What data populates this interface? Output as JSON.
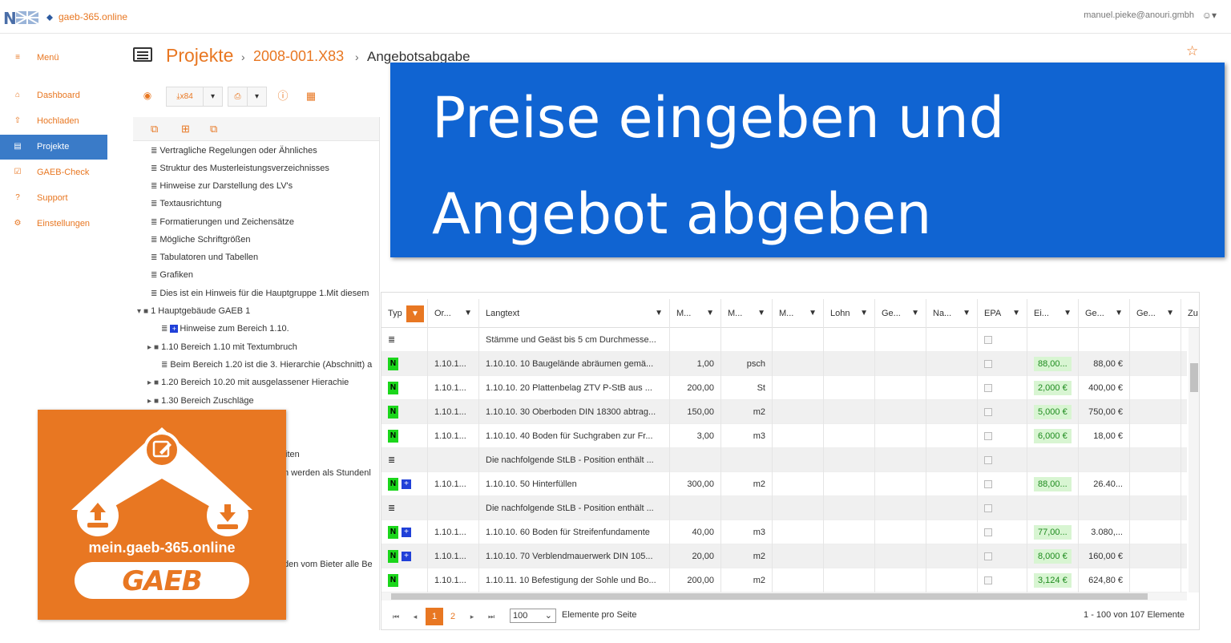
{
  "topbar": {
    "brand": "gaeb-365.online",
    "user": "manuel.pieke@anouri.gmbh",
    "user_icon": "☺▾"
  },
  "sidebar": {
    "items": [
      {
        "icon": "≡",
        "label": "Menü",
        "active": false
      },
      {
        "icon": "⌂",
        "label": "Dashboard",
        "active": false
      },
      {
        "icon": "⇧",
        "label": "Hochladen",
        "active": false
      },
      {
        "icon": "▤",
        "label": "Projekte",
        "active": true
      },
      {
        "icon": "☑",
        "label": "GAEB-Check",
        "active": false
      },
      {
        "icon": "?",
        "label": "Support",
        "active": false
      },
      {
        "icon": "⚙",
        "label": "Einstellungen",
        "active": false
      }
    ]
  },
  "breadcrumb": {
    "root": "Projekte",
    "sep1": "›",
    "project": "2008-001.X83",
    "sep2": "›",
    "page": "Angebotsabgabe"
  },
  "toolbar": {
    "eye": "◉",
    "export_label": "⤓x84",
    "caret": "▾",
    "pdf": "⎙",
    "info": "ⓘ",
    "calc": "▦"
  },
  "tree": {
    "head_icons": [
      "⧉",
      "⊞",
      "⧉"
    ],
    "nodes": [
      "Vertragliche Regelungen oder Ähnliches",
      "Struktur des Musterleistungsverzeichnisses",
      "Hinweise zur Darstellung des LV's",
      "Textausrichtung",
      "Formatierungen und Zeichensätze",
      "Mögliche Schriftgrößen",
      "Tabulatoren und Tabellen",
      "Grafiken",
      "Dies ist ein Hinweis für die Hauptgruppe 1.Mit diesem",
      "1 Hauptgebäude GAEB 1",
      "Hinweise zum Bereich 1.10.",
      "1.10 Bereich 1.10 mit Textumbruch",
      "Beim Bereich 1.20 ist die 3. Hierarchie (Abschnitt) a",
      "1.20 Bereich 10.20 mit ausgelassener Hierachie",
      "1.30 Bereich Zuschläge",
      "iten",
      "n werden als Stundenl",
      "den vom Bieter alle Be"
    ],
    "expand": "▸",
    "collapse": "▾",
    "text_icon": "≣",
    "book_icon": "■",
    "plus": "+"
  },
  "grid": {
    "headers": [
      "Typ",
      "Or...",
      "Langtext",
      "M...",
      "M...",
      "M...",
      "Lohn",
      "Ge...",
      "Na...",
      "EPA",
      "Ei...",
      "Ge...",
      "Ge...",
      "Zu"
    ],
    "filter_icon": "▼",
    "rows": [
      {
        "typ": "text",
        "ord": "",
        "lang": "Stämme und Geäst bis 5 cm Durchmesse...",
        "menge": "",
        "einheit": "",
        "ep": "",
        "gp": "",
        "alt": false
      },
      {
        "typ": "N",
        "ord": "1.10.1...",
        "lang": "1.10.10. 10 Baugelände abräumen gemä...",
        "menge": "1,00",
        "einheit": "psch",
        "ep": "88,00...",
        "gp": "88,00 €",
        "alt": true
      },
      {
        "typ": "N",
        "ord": "1.10.1...",
        "lang": "1.10.10. 20 Plattenbelag ZTV P-StB aus ...",
        "menge": "200,00",
        "einheit": "St",
        "ep": "2,000 €",
        "gp": "400,00 €",
        "alt": false
      },
      {
        "typ": "N",
        "ord": "1.10.1...",
        "lang": "1.10.10. 30 Oberboden DIN 18300 abtrag...",
        "menge": "150,00",
        "einheit": "m2",
        "ep": "5,000 €",
        "gp": "750,00 €",
        "alt": true
      },
      {
        "typ": "N",
        "ord": "1.10.1...",
        "lang": "1.10.10. 40 Boden für Suchgraben zur Fr...",
        "menge": "3,00",
        "einheit": "m3",
        "ep": "6,000 €",
        "gp": "18,00 €",
        "alt": false
      },
      {
        "typ": "text",
        "ord": "",
        "lang": "Die nachfolgende StLB - Position enthält ...",
        "menge": "",
        "einheit": "",
        "ep": "",
        "gp": "",
        "alt": true
      },
      {
        "typ": "N+",
        "ord": "1.10.1...",
        "lang": "1.10.10. 50 Hinterfüllen",
        "menge": "300,00",
        "einheit": "m2",
        "ep": "88,00...",
        "gp": "26.40...",
        "alt": false
      },
      {
        "typ": "text",
        "ord": "",
        "lang": "Die nachfolgende StLB - Position enthält ...",
        "menge": "",
        "einheit": "",
        "ep": "",
        "gp": "",
        "alt": true
      },
      {
        "typ": "N+",
        "ord": "1.10.1...",
        "lang": "1.10.10. 60 Boden für Streifenfundamente",
        "menge": "40,00",
        "einheit": "m3",
        "ep": "77,00...",
        "gp": "3.080,...",
        "alt": false
      },
      {
        "typ": "N+",
        "ord": "1.10.1...",
        "lang": "1.10.10. 70 Verblendmauerwerk DIN 105...",
        "menge": "20,00",
        "einheit": "m2",
        "ep": "8,000 €",
        "gp": "160,00 €",
        "alt": true
      },
      {
        "typ": "N",
        "ord": "1.10.1...",
        "lang": "1.10.11. 10 Befestigung der Sohle und Bo...",
        "menge": "200,00",
        "einheit": "m2",
        "ep": "3,124 €",
        "gp": "624,80 €",
        "alt": false
      }
    ],
    "pager": {
      "first": "⏮",
      "prev": "◂",
      "page1": "1",
      "page2": "2",
      "next": "▸",
      "last": "⏭",
      "size": "100",
      "size_caret": "⌄",
      "per_page": "Elemente pro Seite",
      "info": "1 - 100 von 107 Elemente"
    }
  },
  "banner": {
    "line1": "Preise eingeben und",
    "line2": "Angebot abgeben"
  },
  "badge": {
    "url": "mein.gaeb-365.online",
    "logo": "GAEB"
  },
  "colors": {
    "accent": "#e87722",
    "active": "#3a7bc8",
    "banner": "#1064d2",
    "green": "#1bd61b",
    "blue": "#2040d8"
  }
}
